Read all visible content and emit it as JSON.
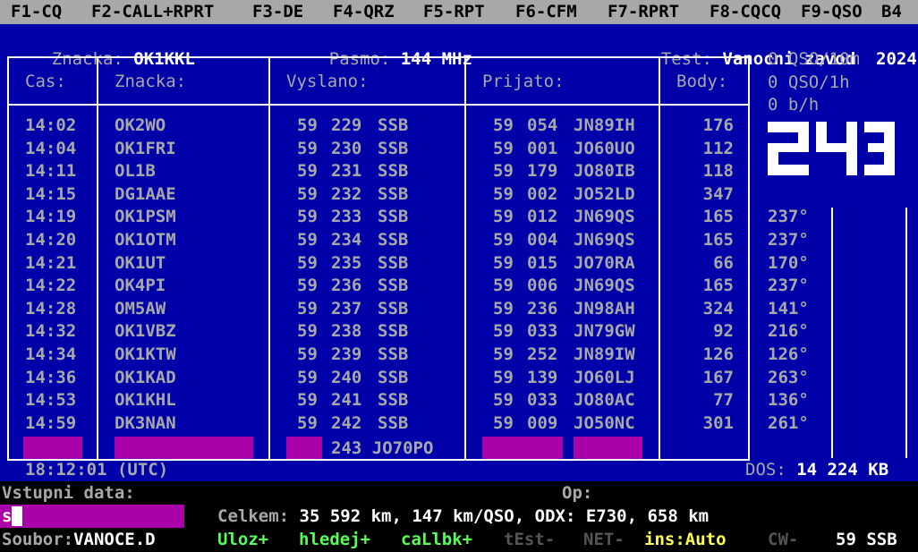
{
  "fkeys": [
    "F1-CQ",
    "F2-CALL+RPRT",
    "F3-DE",
    "F4-QRZ",
    "F5-RPT",
    "F6-CFM",
    "F7-RPRT",
    "F8-CQCQ",
    "F9-QSO",
    "B4"
  ],
  "status": {
    "callsign_label": "Znacka:",
    "callsign": "OK1KKL",
    "band_label": "Pasmo:",
    "band": "144 MHz",
    "test_label": "Test:",
    "test_name": "Vanocni zavod",
    "year": "2024"
  },
  "headers": {
    "time": "Cas:",
    "call": "Znacka:",
    "sent": "Vyslano:",
    "recv": "Prijato:",
    "points": "Body:"
  },
  "rates": {
    "qso10m": "0 QSO/10m",
    "qso1h": "0 QSO/1h",
    "bh": "0 b/h"
  },
  "next_serial": "243",
  "qsos": [
    {
      "time": "14:02",
      "call": "OK2WO",
      "rst_s": "59",
      "nr_s": "229",
      "mode": "SSB",
      "rst_r": "59",
      "nr_r": "054",
      "loc": "JN89IH",
      "pts": "176",
      "az": ""
    },
    {
      "time": "14:04",
      "call": "OK1FRI",
      "rst_s": "59",
      "nr_s": "230",
      "mode": "SSB",
      "rst_r": "59",
      "nr_r": "001",
      "loc": "JO60UO",
      "pts": "112",
      "az": ""
    },
    {
      "time": "14:11",
      "call": "OL1B",
      "rst_s": "59",
      "nr_s": "231",
      "mode": "SSB",
      "rst_r": "59",
      "nr_r": "179",
      "loc": "JO80IB",
      "pts": "118",
      "az": ""
    },
    {
      "time": "14:15",
      "call": "DG1AAE",
      "rst_s": "59",
      "nr_s": "232",
      "mode": "SSB",
      "rst_r": "59",
      "nr_r": "002",
      "loc": "JO52LD",
      "pts": "347",
      "az": ""
    },
    {
      "time": "14:19",
      "call": "OK1PSM",
      "rst_s": "59",
      "nr_s": "233",
      "mode": "SSB",
      "rst_r": "59",
      "nr_r": "012",
      "loc": "JN69QS",
      "pts": "165",
      "az": "237°"
    },
    {
      "time": "14:20",
      "call": "OK1OTM",
      "rst_s": "59",
      "nr_s": "234",
      "mode": "SSB",
      "rst_r": "59",
      "nr_r": "004",
      "loc": "JN69QS",
      "pts": "165",
      "az": "237°"
    },
    {
      "time": "14:21",
      "call": "OK1UT",
      "rst_s": "59",
      "nr_s": "235",
      "mode": "SSB",
      "rst_r": "59",
      "nr_r": "015",
      "loc": "JO70RA",
      "pts": "66",
      "az": "170°"
    },
    {
      "time": "14:22",
      "call": "OK4PI",
      "rst_s": "59",
      "nr_s": "236",
      "mode": "SSB",
      "rst_r": "59",
      "nr_r": "006",
      "loc": "JN69QS",
      "pts": "165",
      "az": "237°"
    },
    {
      "time": "14:28",
      "call": "OM5AW",
      "rst_s": "59",
      "nr_s": "237",
      "mode": "SSB",
      "rst_r": "59",
      "nr_r": "236",
      "loc": "JN98AH",
      "pts": "324",
      "az": "141°"
    },
    {
      "time": "14:32",
      "call": "OK1VBZ",
      "rst_s": "59",
      "nr_s": "238",
      "mode": "SSB",
      "rst_r": "59",
      "nr_r": "033",
      "loc": "JN79GW",
      "pts": "92",
      "az": "216°"
    },
    {
      "time": "14:34",
      "call": "OK1KTW",
      "rst_s": "59",
      "nr_s": "239",
      "mode": "SSB",
      "rst_r": "59",
      "nr_r": "252",
      "loc": "JN89IW",
      "pts": "126",
      "az": "126°"
    },
    {
      "time": "14:36",
      "call": "OK1KAD",
      "rst_s": "59",
      "nr_s": "240",
      "mode": "SSB",
      "rst_r": "59",
      "nr_r": "139",
      "loc": "JO60LJ",
      "pts": "167",
      "az": "263°"
    },
    {
      "time": "14:53",
      "call": "OK1KHL",
      "rst_s": "59",
      "nr_s": "241",
      "mode": "SSB",
      "rst_r": "59",
      "nr_r": "033",
      "loc": "JO80AC",
      "pts": "77",
      "az": "136°"
    },
    {
      "time": "14:59",
      "call": "DK3NAN",
      "rst_s": "59",
      "nr_s": "242",
      "mode": "SSB",
      "rst_r": "59",
      "nr_r": "009",
      "loc": "JO50NC",
      "pts": "301",
      "az": "261°"
    }
  ],
  "edit_row": {
    "sent_nr": "243",
    "sent_loc": "JO70PO"
  },
  "clock": "18:12:01 (UTC)",
  "dos": {
    "label": "DOS:",
    "value": "14 224 KB"
  },
  "input": {
    "label": "Vstupni data:",
    "value": "s",
    "op_label": "Op:"
  },
  "stats": {
    "label": "Celkem:",
    "value": "35 592 km, 147 km/QSO, ODX: E730, 658 km"
  },
  "footer": {
    "file_label": "Soubor:",
    "file": "VANOCE.D",
    "uloz": "Uloz+",
    "hledej": "hledej+",
    "callbk": "caLlbk+",
    "test": "tEst-",
    "net": "NET-",
    "ins": "ins:Auto",
    "cw": "CW-",
    "report": "59 SSB"
  },
  "colors": {
    "bg": "#0000a8",
    "highlight": "#aa00aa",
    "text": "#a8a8a8",
    "bright": "#ffffff",
    "green": "#55ff55",
    "yellow": "#ffff55"
  }
}
